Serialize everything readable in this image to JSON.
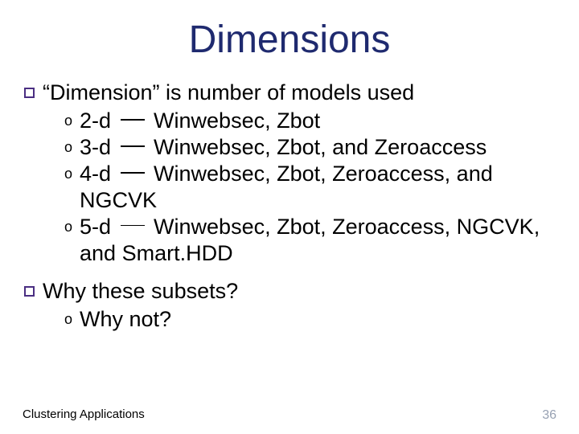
{
  "title": "Dimensions",
  "points": [
    {
      "text": "“Dimension” is number of models used",
      "sub": [
        {
          "pre": "2-d ",
          "post": " Winwebsec, Zbot"
        },
        {
          "pre": "3-d ",
          "post": "  Winwebsec, Zbot, and Zeroaccess"
        },
        {
          "pre": "4-d ",
          "post": " Winwebsec, Zbot, Zeroaccess, and NGCVK"
        },
        {
          "pre": "5-d ",
          "post": " Winwebsec, Zbot, Zeroaccess, NGCVK, and Smart.HDD"
        }
      ]
    },
    {
      "text": "Why these subsets?",
      "sub": [
        {
          "plain": "Why not?"
        }
      ]
    }
  ],
  "footer_left": "Clustering Applications",
  "footer_right": "36"
}
